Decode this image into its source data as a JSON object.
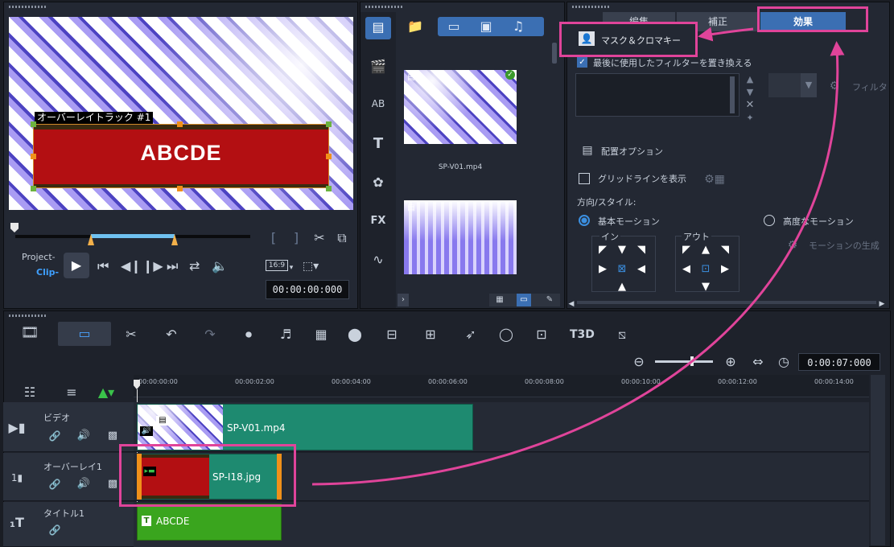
{
  "preview": {
    "overlay_label": "オーバーレイトラック #1",
    "overlay_text": "ABCDE",
    "project_label": "Project-",
    "clip_label": "Clip-",
    "aspect": "16:9",
    "timecode": "00:00:00:000"
  },
  "library": {
    "clips": [
      {
        "name": "SP-V01.mp4"
      },
      {
        "name": ""
      }
    ]
  },
  "options": {
    "tabs": [
      "編集",
      "補正",
      "効果"
    ],
    "mask_button": "マスク＆クロマキー",
    "replace_filter": "最後に使用したフィルターを置き換える",
    "filter_label": "フィルタ",
    "placement_options": "配置オプション",
    "show_grid": "グリッドラインを表示",
    "direction_style": "方向/スタイル:",
    "basic_motion": "基本モーション",
    "advanced_motion": "高度なモーション",
    "in_label": "イン",
    "out_label": "アウト",
    "generate_motion": "モーションの生成"
  },
  "timeline": {
    "timecode": "0:00:07:000",
    "ruler": [
      "00:00:00:00",
      "00:00:02:00",
      "00:00:04:00",
      "00:00:06:00",
      "00:00:08:00",
      "00:00:10:00",
      "00:00:12:00",
      "00:00:14:00"
    ],
    "tracks": [
      {
        "name": "ビデオ",
        "clip": "SP-V01.mp4"
      },
      {
        "name": "オーバーレイ1",
        "clip": "SP-I18.jpg"
      },
      {
        "name": "タイトル1",
        "clip": "ABCDE"
      }
    ]
  },
  "colors": {
    "highlight": "#e0449a",
    "video_clip": "#1e8a70",
    "title_clip": "#3aa51e",
    "accent": "#3b6fb3"
  }
}
